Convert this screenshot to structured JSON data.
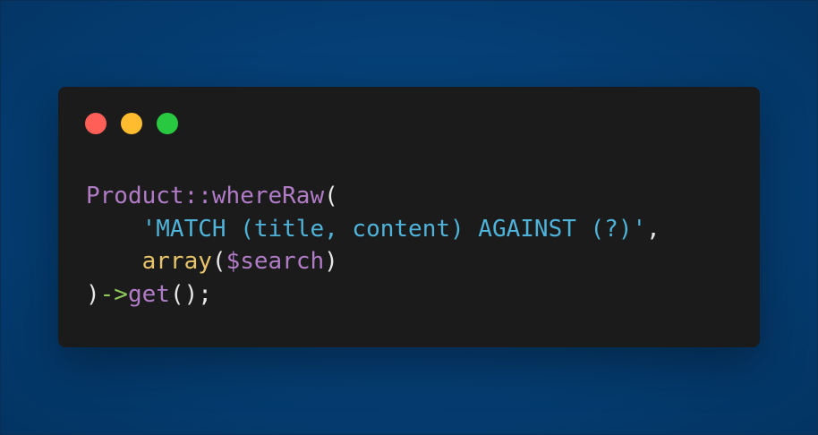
{
  "window": {
    "buttons": {
      "close": "close",
      "minimize": "minimize",
      "maximize": "maximize"
    },
    "colors": {
      "close": "#ff5f57",
      "minimize": "#febc2e",
      "maximize": "#28c840",
      "window_bg": "#1b1b1c",
      "page_bg": "#053f75"
    }
  },
  "code": {
    "line1": {
      "class": "Product",
      "op": "::",
      "method": "whereRaw",
      "paren": "("
    },
    "line2": {
      "indent": "    ",
      "string": "'MATCH (title, content) AGAINST (?)'",
      "comma": ","
    },
    "line3": {
      "indent": "    ",
      "func": "array",
      "open": "(",
      "var": "$search",
      "close": ")"
    },
    "line4": {
      "close": ")",
      "arrow": "->",
      "method": "get",
      "call": "();"
    }
  }
}
